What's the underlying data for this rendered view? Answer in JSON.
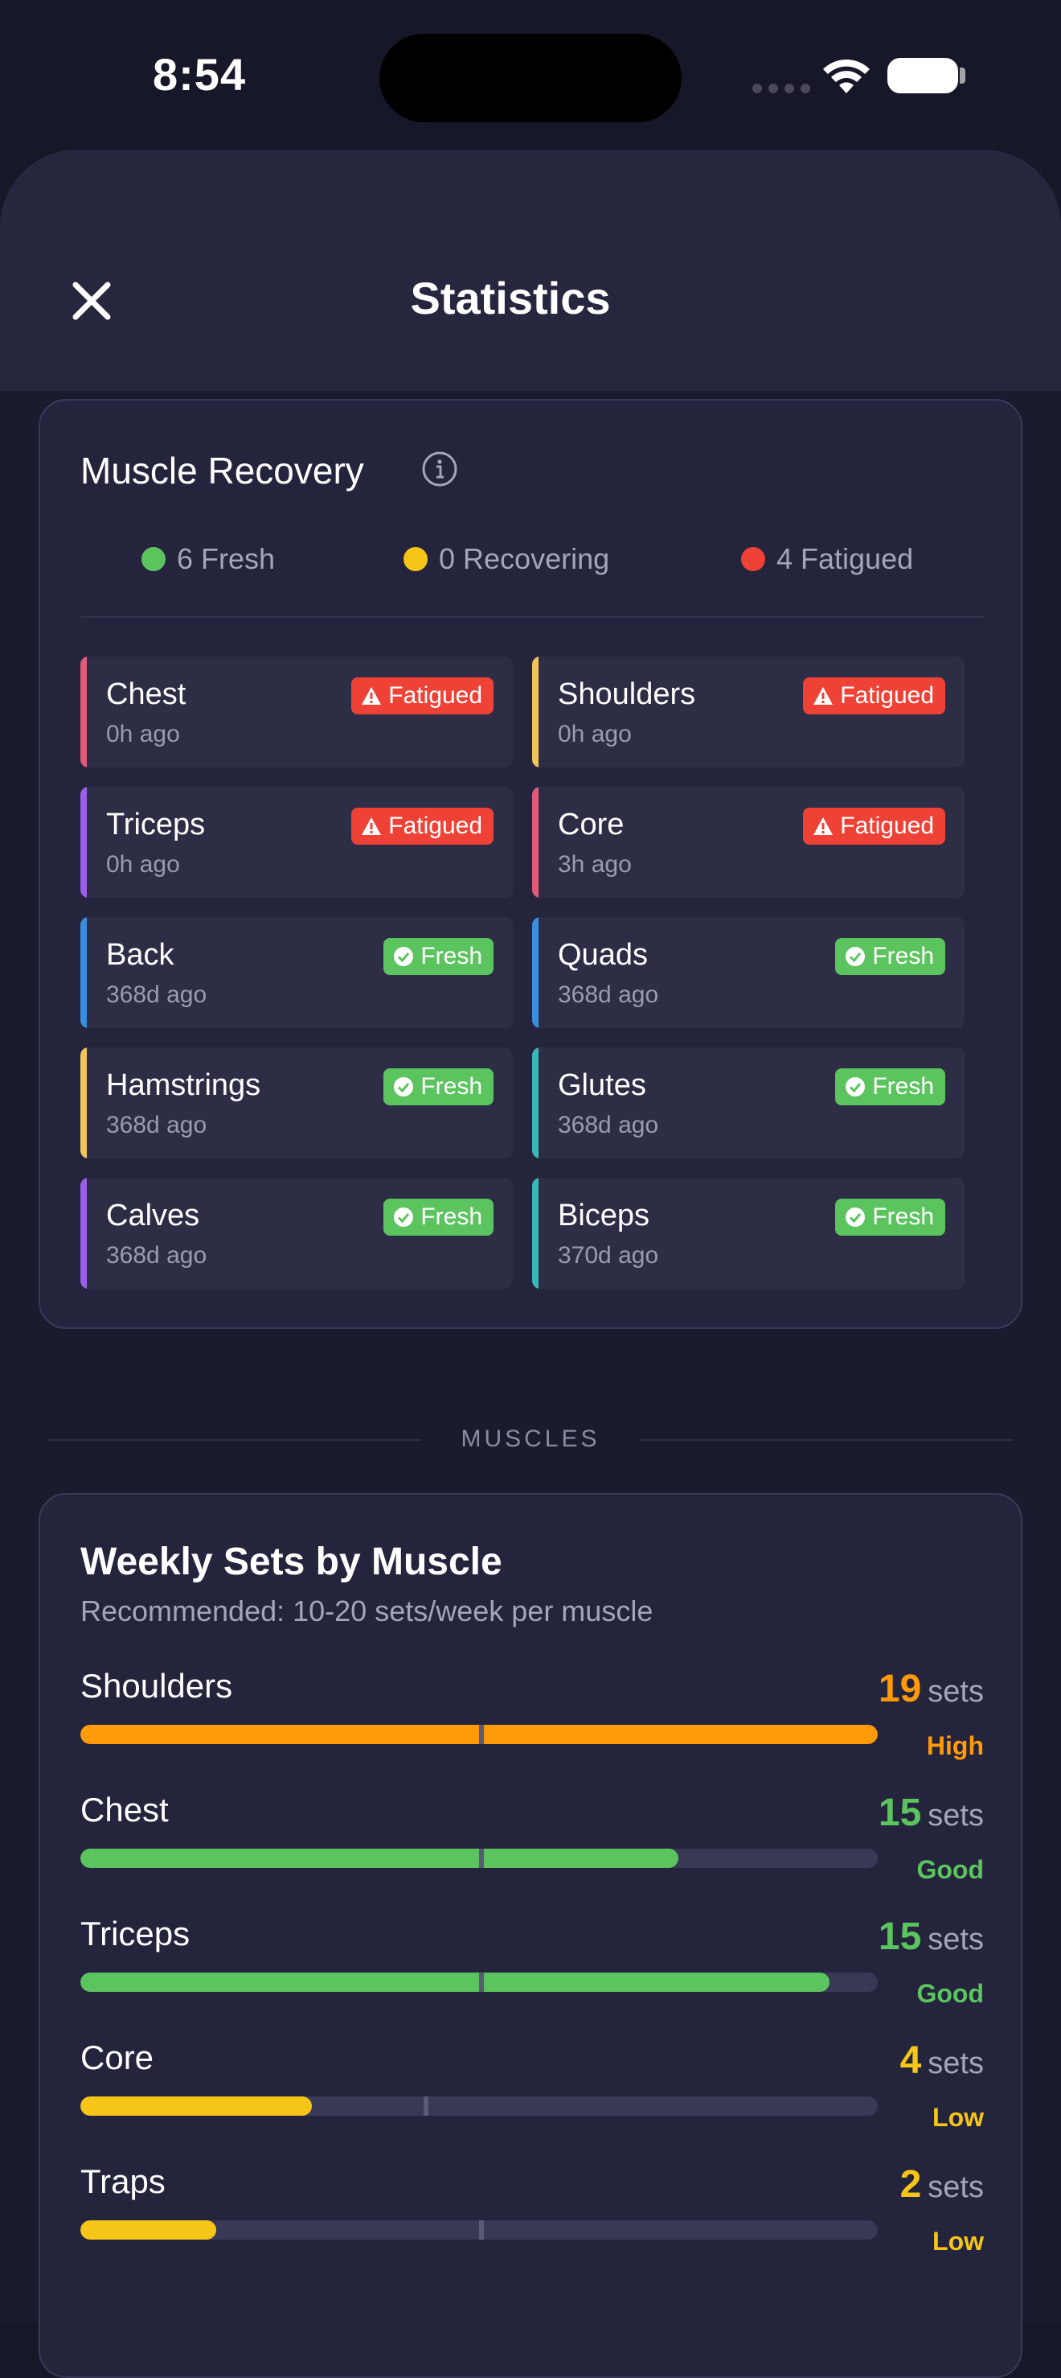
{
  "status_bar": {
    "time": "8:54"
  },
  "header": {
    "title": "Statistics"
  },
  "recovery": {
    "title": "Muscle Recovery",
    "summary": [
      {
        "label": "6 Fresh",
        "color": "#5cc45e"
      },
      {
        "label": "0 Recovering",
        "color": "#f5c518"
      },
      {
        "label": "4 Fatigued",
        "color": "#ee4236"
      }
    ],
    "muscles": [
      {
        "name": "Chest",
        "ago": "0h ago",
        "status": "Fatigued",
        "accent": "#e25a7a"
      },
      {
        "name": "Shoulders",
        "ago": "0h ago",
        "status": "Fatigued",
        "accent": "#f2c55a"
      },
      {
        "name": "Triceps",
        "ago": "0h ago",
        "status": "Fatigued",
        "accent": "#9a5fe8"
      },
      {
        "name": "Core",
        "ago": "3h ago",
        "status": "Fatigued",
        "accent": "#e25a7a"
      },
      {
        "name": "Back",
        "ago": "368d ago",
        "status": "Fresh",
        "accent": "#3a8ee0"
      },
      {
        "name": "Quads",
        "ago": "368d ago",
        "status": "Fresh",
        "accent": "#3a8ee0"
      },
      {
        "name": "Hamstrings",
        "ago": "368d ago",
        "status": "Fresh",
        "accent": "#f2c55a"
      },
      {
        "name": "Glutes",
        "ago": "368d ago",
        "status": "Fresh",
        "accent": "#3ab8b8"
      },
      {
        "name": "Calves",
        "ago": "368d ago",
        "status": "Fresh",
        "accent": "#9a5fe8"
      },
      {
        "name": "Biceps",
        "ago": "370d ago",
        "status": "Fresh",
        "accent": "#3ab8b8"
      }
    ]
  },
  "section_label": "MUSCLES",
  "weekly": {
    "title": "Weekly Sets by Muscle",
    "subtitle": "Recommended: 10-20 sets/week per muscle",
    "unit": "sets",
    "rows": [
      {
        "name": "Shoulders",
        "sets": "19",
        "status": "High",
        "color": "#ff9a0a",
        "fill_fraction": 1.0,
        "tick_fraction": 0.5
      },
      {
        "name": "Chest",
        "sets": "15",
        "status": "Good",
        "color": "#5cc45e",
        "fill_fraction": 0.75,
        "tick_fraction": 0.5
      },
      {
        "name": "Triceps",
        "sets": "15",
        "status": "Good",
        "color": "#5cc45e",
        "fill_fraction": 0.94,
        "tick_fraction": 0.5
      },
      {
        "name": "Core",
        "sets": "4",
        "status": "Low",
        "color": "#f5c518",
        "fill_fraction": 0.29,
        "tick_fraction": 0.43
      },
      {
        "name": "Traps",
        "sets": "2",
        "status": "Low",
        "color": "#f5c518",
        "fill_fraction": 0.17,
        "tick_fraction": 0.5
      }
    ]
  }
}
